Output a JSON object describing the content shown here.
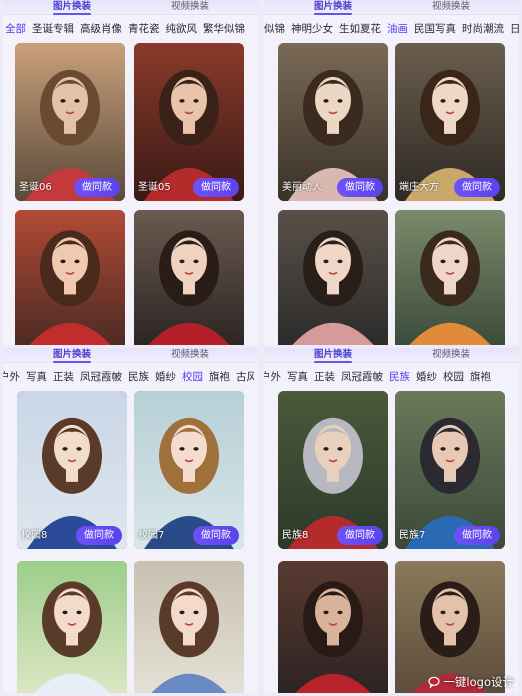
{
  "panels": [
    {
      "tabs": [
        "图片换装",
        "视频换装"
      ],
      "active_tab": 0,
      "categories": [
        "全部",
        "圣诞专辑",
        "高级肖像",
        "青花瓷",
        "纯欲风",
        "繁华似锦"
      ],
      "active_category": 0,
      "cards": [
        {
          "label": "圣诞06",
          "button": "做同款",
          "palette": [
            "#5a4a3a",
            "#c9a07a",
            "#e3c2a6",
            "#6b4a32",
            "#c33a3a"
          ]
        },
        {
          "label": "圣诞05",
          "button": "做同款",
          "palette": [
            "#3a1a16",
            "#8a3a2a",
            "#e9c3aa",
            "#3a2218",
            "#b52a2a"
          ]
        },
        {
          "label": "",
          "button": "",
          "palette": [
            "#4a2a22",
            "#b24a36",
            "#f0c9b0",
            "#4a2a1a",
            "#c12c2c"
          ]
        },
        {
          "label": "",
          "button": "",
          "palette": [
            "#2a2422",
            "#6a5a50",
            "#efd2c0",
            "#2a1c16",
            "#b3202a"
          ]
        }
      ]
    },
    {
      "tabs": [
        "图片换装",
        "视频换装"
      ],
      "active_tab": 0,
      "categories": [
        "似锦",
        "神明少女",
        "生如夏花",
        "油画",
        "民国写真",
        "时尚潮流",
        "日系"
      ],
      "active_category": 3,
      "cards": [
        {
          "label": "美丽动人",
          "button": "做同款",
          "palette": [
            "#3a3228",
            "#7a6a56",
            "#ecd6c4",
            "#3a2a20",
            "#d9b8b0"
          ]
        },
        {
          "label": "端庄大方",
          "button": "做同款",
          "palette": [
            "#2e2a24",
            "#6a5e4e",
            "#efd8c6",
            "#3a2618",
            "#c9a86a"
          ]
        },
        {
          "label": "",
          "button": "",
          "palette": [
            "#2a2a2a",
            "#5a5048",
            "#f0d6c6",
            "#2a1e18",
            "#d69a9a"
          ]
        },
        {
          "label": "",
          "button": "",
          "palette": [
            "#3a4a3a",
            "#7a8a6a",
            "#efd6c6",
            "#3a2a1e",
            "#e08a3a"
          ]
        }
      ]
    },
    {
      "tabs": [
        "图片换装",
        "视频换装"
      ],
      "active_tab": 0,
      "categories": [
        "户外",
        "写真",
        "正装",
        "凤冠霞帔",
        "民族",
        "婚纱",
        "校园",
        "旗袍",
        "古风"
      ],
      "active_category": 6,
      "cards": [
        {
          "label": "校园8",
          "button": "做同款",
          "palette": [
            "#dfe6ee",
            "#c9d6e6",
            "#f2dccc",
            "#5a3a28",
            "#2b4a9a"
          ]
        },
        {
          "label": "校园7",
          "button": "做同款",
          "palette": [
            "#d8e6e8",
            "#b6cfd6",
            "#f4ddcf",
            "#a0703a",
            "#2a4a8a"
          ]
        },
        {
          "label": "",
          "button": "",
          "palette": [
            "#dfe8c8",
            "#9ccd8a",
            "#f4dccc",
            "#5a3a28",
            "#e8eef8"
          ]
        },
        {
          "label": "",
          "button": "",
          "palette": [
            "#e6e2d8",
            "#c8c0b0",
            "#f3dacb",
            "#5a3a2a",
            "#6a8ac4"
          ]
        }
      ]
    },
    {
      "tabs": [
        "图片换装",
        "视频换装"
      ],
      "active_tab": 0,
      "categories": [
        "户外",
        "写真",
        "正装",
        "凤冠霞帔",
        "民族",
        "婚纱",
        "校园",
        "旗袍"
      ],
      "active_category": 4,
      "cards": [
        {
          "label": "民族8",
          "button": "做同款",
          "palette": [
            "#2a3a2a",
            "#4a5a3a",
            "#e9cfbe",
            "#b8b8c0",
            "#b52a2a"
          ]
        },
        {
          "label": "民族7",
          "button": "做同款",
          "palette": [
            "#3a4a3a",
            "#6a7a5a",
            "#e7c9b5",
            "#2a2a30",
            "#2a6ab4"
          ]
        },
        {
          "label": "",
          "button": "",
          "palette": [
            "#2a2222",
            "#5a3a30",
            "#d9b49a",
            "#2a1a16",
            "#b8222a"
          ]
        },
        {
          "label": "",
          "button": "",
          "palette": [
            "#5a4a3a",
            "#8a7a5a",
            "#e2c2aa",
            "#2a1c16",
            "#b02a3a"
          ]
        }
      ]
    }
  ],
  "watermark": {
    "text": "一键logo设计",
    "icon": "chat-bubble-icon"
  }
}
